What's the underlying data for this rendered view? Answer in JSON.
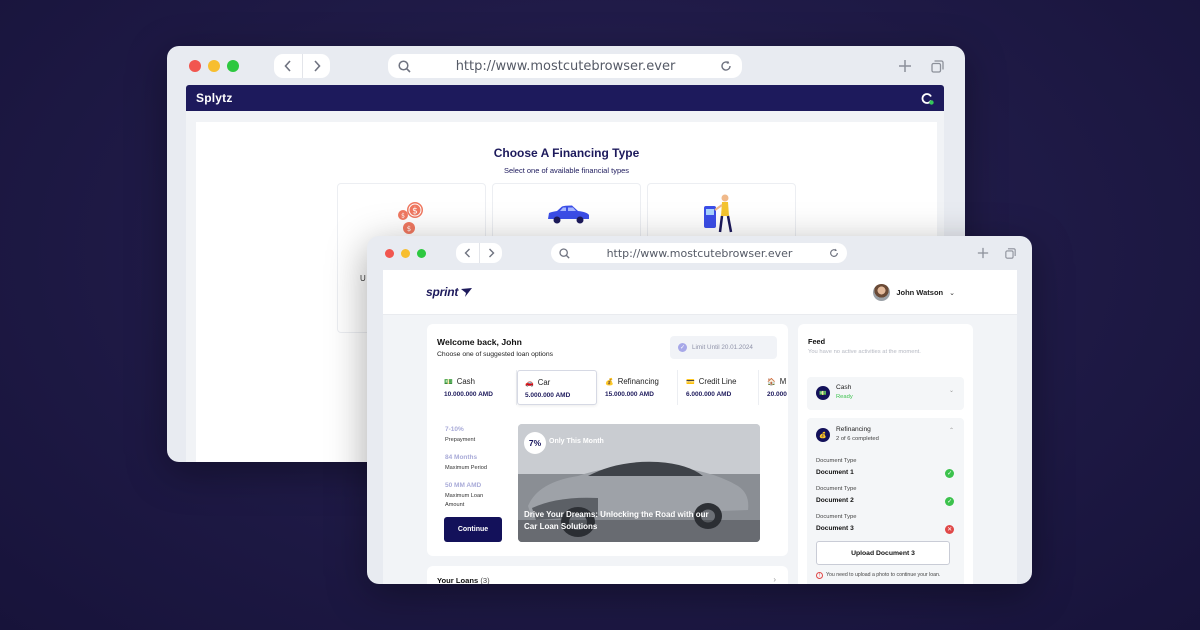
{
  "back_window": {
    "url": "http://www.mostcutebrowser.ever",
    "app_brand": "Splytz",
    "title": "Choose A Financing Type",
    "subtitle": "Select one of available financial types",
    "card_label_fragment": "U"
  },
  "front_window": {
    "url": "http://www.mostcutebrowser.ever",
    "app_brand": "sprint",
    "user_name": "John Watson",
    "welcome": "Welcome back, John",
    "welcome_sub": "Choose one of suggested loan options",
    "limit": "Limit Until 20.01.2024",
    "loan_types": [
      {
        "name": "Cash",
        "amount": "10.000.000 AMD",
        "icon": "cash-icon"
      },
      {
        "name": "Car",
        "amount": "5.000.000 AMD",
        "icon": "car-icon"
      },
      {
        "name": "Refinancing",
        "amount": "15.000.000 AMD",
        "icon": "money-bag-icon"
      },
      {
        "name": "Credit Line",
        "amount": "6.000.000 AMD",
        "icon": "credit-card-icon"
      },
      {
        "name": "M",
        "amount": "20.000",
        "icon": "house-icon"
      }
    ],
    "stats": [
      {
        "value": "7-10%",
        "label": "Prepayment"
      },
      {
        "value": "84 Months",
        "label": "Maximum Period"
      },
      {
        "value": "50 MM AMD",
        "label": "Maximum Loan Amount"
      }
    ],
    "continue_label": "Continue",
    "promo": {
      "badge": "7%",
      "tag": "Only This Month",
      "title": "Drive Your Dreams: Unlocking the Road with our Car Loan Solutions"
    },
    "loans": {
      "label": "Your Loans",
      "count": "(3)"
    },
    "feed": {
      "title": "Feed",
      "empty_text": "You have no active activities at the moment.",
      "cash": {
        "name": "Cash",
        "status": "Ready"
      },
      "refinancing": {
        "name": "Refinancing",
        "status": "2 of 6 completed"
      },
      "documents": [
        {
          "type": "Document Type",
          "name": "Document 1",
          "state": "done"
        },
        {
          "type": "Document Type",
          "name": "Document 2",
          "state": "done"
        },
        {
          "type": "Document Type",
          "name": "Document 3",
          "state": "missing"
        }
      ],
      "upload_label": "Upload Document 3",
      "warning": "You need to upload a photo to continue your loan."
    }
  },
  "colors": {
    "navy": "#13115a",
    "accent_soft": "#a9abd8",
    "success": "#3cc24d",
    "error": "#e04848",
    "mac_red": "#f1564f",
    "mac_yellow": "#f7be2f",
    "mac_green": "#2dc840"
  }
}
